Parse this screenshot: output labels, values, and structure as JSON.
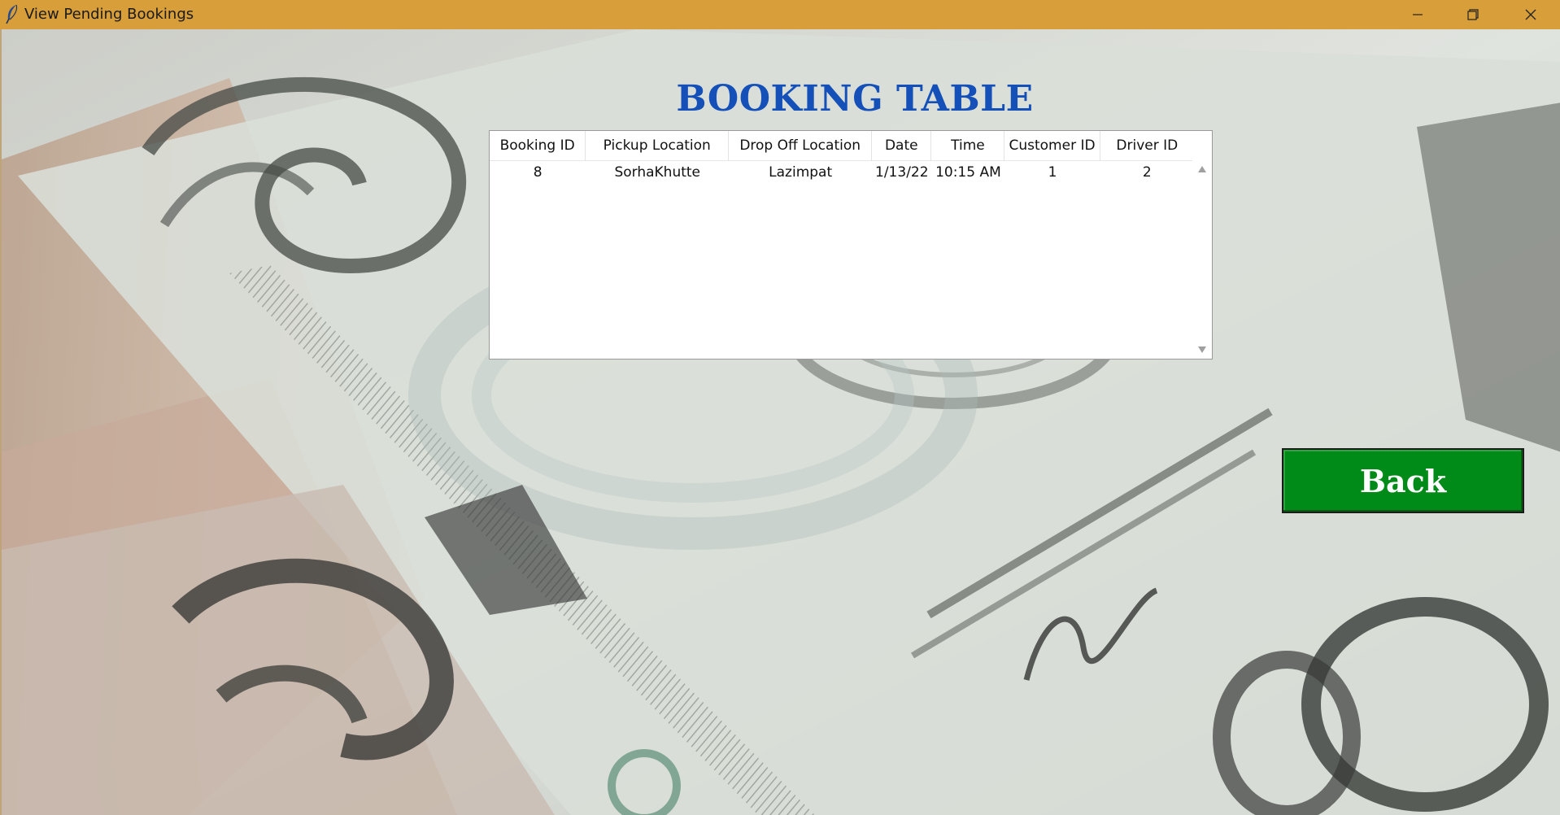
{
  "window": {
    "title": "View Pending Bookings",
    "titlebar_color": "#d79e3a"
  },
  "heading": {
    "text": "BOOKING TABLE",
    "color": "#1450b8"
  },
  "table": {
    "columns": [
      "Booking ID",
      "Pickup Location",
      "Drop Off Location",
      "Date",
      "Time",
      "Customer ID",
      "Driver ID"
    ],
    "rows": [
      [
        "8",
        "SorhaKhutte",
        "Lazimpat",
        "1/13/22",
        "10:15 AM",
        "1",
        "2"
      ]
    ]
  },
  "back_button": {
    "label": "Back",
    "color": "#008a17"
  },
  "icons": {
    "app": "feather-icon",
    "minimize": "minimize-icon",
    "maximize": "restore-icon",
    "close": "close-icon",
    "scroll_up": "chevron-up-icon",
    "scroll_down": "chevron-down-icon"
  }
}
